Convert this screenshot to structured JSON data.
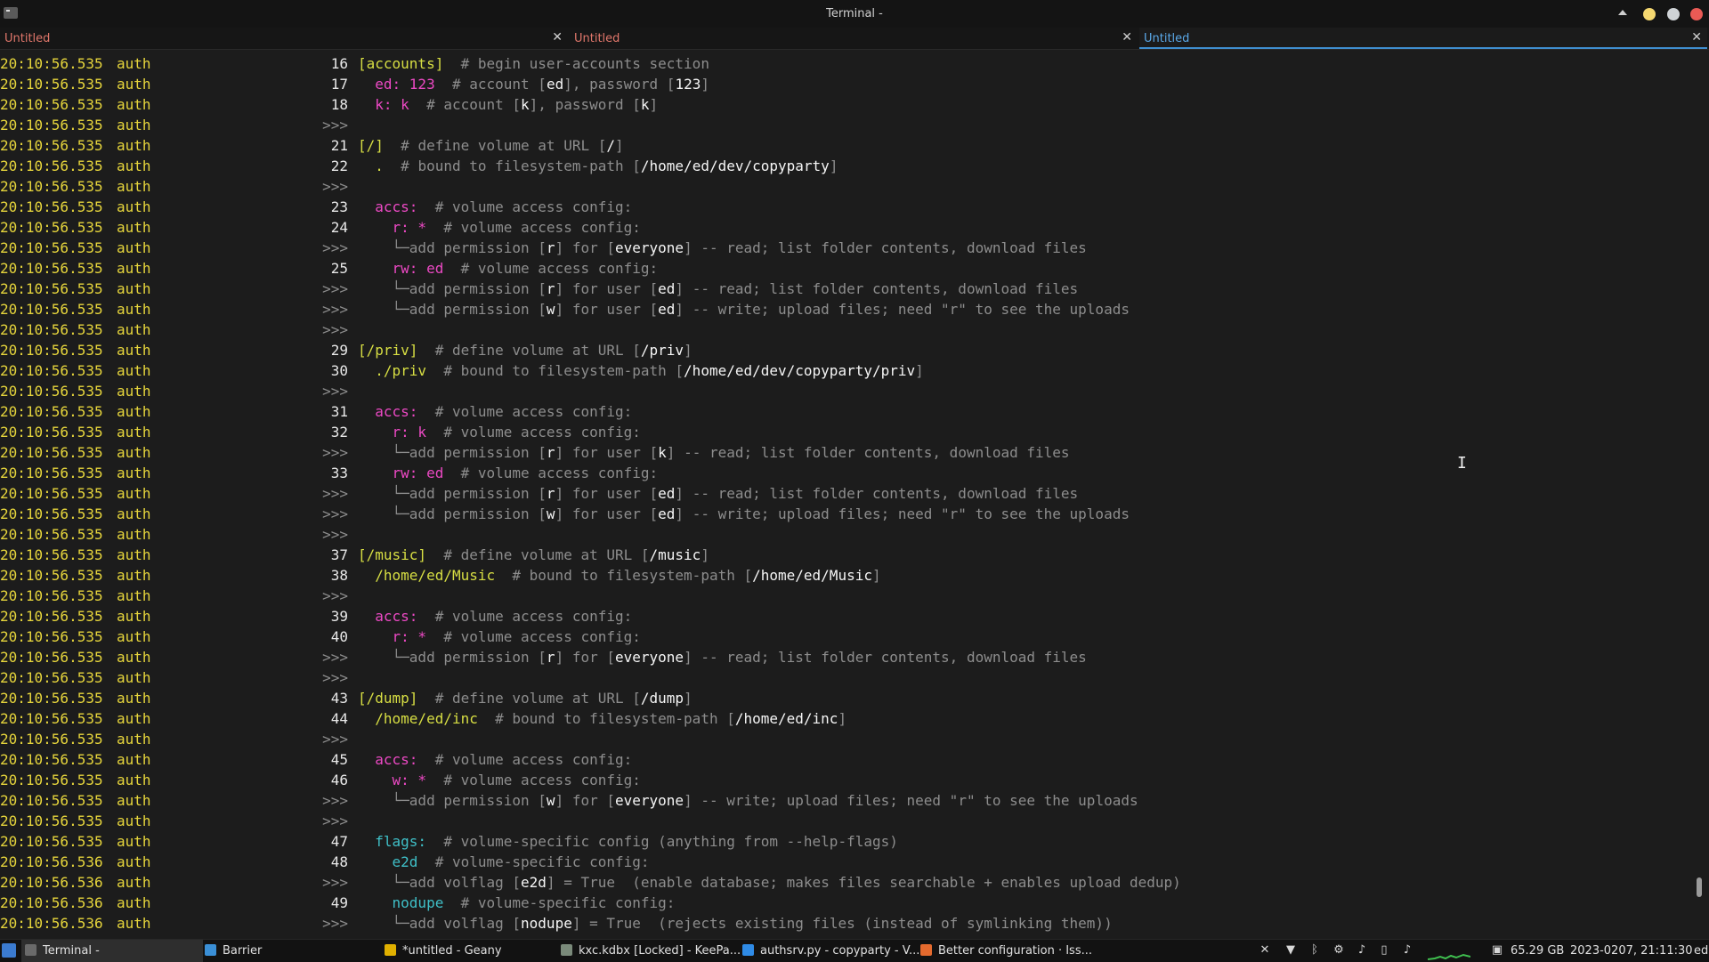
{
  "window": {
    "title": "Terminal -"
  },
  "tabs": [
    {
      "label": "Untitled",
      "close": "✕",
      "active": false
    },
    {
      "label": "Untitled",
      "close": "✕",
      "active": false
    },
    {
      "label": "Untitled",
      "close": "✕",
      "active": true
    }
  ],
  "terminal": {
    "lines": [
      {
        "ts": "20:10:56.535",
        "lvl": "auth",
        "ln": "16",
        "parts": [
          [
            "y",
            "[accounts]"
          ],
          [
            "g",
            "  # begin user-accounts section"
          ]
        ]
      },
      {
        "ts": "20:10:56.535",
        "lvl": "auth",
        "ln": "17",
        "parts": [
          [
            "m",
            "  ed: 123"
          ],
          [
            "g",
            "  # account ["
          ],
          [
            "w",
            "ed"
          ],
          [
            "g",
            "], password ["
          ],
          [
            "w",
            "123"
          ],
          [
            "g",
            "]"
          ]
        ]
      },
      {
        "ts": "20:10:56.535",
        "lvl": "auth",
        "ln": "18",
        "parts": [
          [
            "m",
            "  k: k"
          ],
          [
            "g",
            "  # account ["
          ],
          [
            "w",
            "k"
          ],
          [
            "g",
            "], password ["
          ],
          [
            "w",
            "k"
          ],
          [
            "g",
            "]"
          ]
        ]
      },
      {
        "ts": "20:10:56.535",
        "lvl": "auth",
        "ln": ">>>",
        "parts": []
      },
      {
        "ts": "20:10:56.535",
        "lvl": "auth",
        "ln": "21",
        "parts": [
          [
            "y",
            "[/]"
          ],
          [
            "g",
            "  # define volume at URL ["
          ],
          [
            "w",
            "/"
          ],
          [
            "g",
            "]"
          ]
        ]
      },
      {
        "ts": "20:10:56.535",
        "lvl": "auth",
        "ln": "22",
        "parts": [
          [
            "y",
            "  ."
          ],
          [
            "g",
            "  # bound to filesystem-path ["
          ],
          [
            "w",
            "/home/ed/dev/copyparty"
          ],
          [
            "g",
            "]"
          ]
        ]
      },
      {
        "ts": "20:10:56.535",
        "lvl": "auth",
        "ln": ">>>",
        "parts": []
      },
      {
        "ts": "20:10:56.535",
        "lvl": "auth",
        "ln": "23",
        "parts": [
          [
            "m",
            "  accs:"
          ],
          [
            "g",
            "  # volume access config:"
          ]
        ]
      },
      {
        "ts": "20:10:56.535",
        "lvl": "auth",
        "ln": "24",
        "parts": [
          [
            "m",
            "    r: *"
          ],
          [
            "g",
            "  # volume access config:"
          ]
        ]
      },
      {
        "ts": "20:10:56.535",
        "lvl": "auth",
        "ln": ">>>",
        "parts": [
          [
            "g",
            "    └─add permission ["
          ],
          [
            "w",
            "r"
          ],
          [
            "g",
            "] for ["
          ],
          [
            "w",
            "everyone"
          ],
          [
            "g",
            "] -- read; list folder contents, download files"
          ]
        ]
      },
      {
        "ts": "20:10:56.535",
        "lvl": "auth",
        "ln": "25",
        "parts": [
          [
            "m",
            "    rw: ed"
          ],
          [
            "g",
            "  # volume access config:"
          ]
        ]
      },
      {
        "ts": "20:10:56.535",
        "lvl": "auth",
        "ln": ">>>",
        "parts": [
          [
            "g",
            "    └─add permission ["
          ],
          [
            "w",
            "r"
          ],
          [
            "g",
            "] for user ["
          ],
          [
            "w",
            "ed"
          ],
          [
            "g",
            "] -- read; list folder contents, download files"
          ]
        ]
      },
      {
        "ts": "20:10:56.535",
        "lvl": "auth",
        "ln": ">>>",
        "parts": [
          [
            "g",
            "    └─add permission ["
          ],
          [
            "w",
            "w"
          ],
          [
            "g",
            "] for user ["
          ],
          [
            "w",
            "ed"
          ],
          [
            "g",
            "] -- write; upload files; need \"r\" to see the uploads"
          ]
        ]
      },
      {
        "ts": "20:10:56.535",
        "lvl": "auth",
        "ln": ">>>",
        "parts": []
      },
      {
        "ts": "20:10:56.535",
        "lvl": "auth",
        "ln": "29",
        "parts": [
          [
            "y",
            "[/priv]"
          ],
          [
            "g",
            "  # define volume at URL ["
          ],
          [
            "w",
            "/priv"
          ],
          [
            "g",
            "]"
          ]
        ]
      },
      {
        "ts": "20:10:56.535",
        "lvl": "auth",
        "ln": "30",
        "parts": [
          [
            "y",
            "  ./priv"
          ],
          [
            "g",
            "  # bound to filesystem-path ["
          ],
          [
            "w",
            "/home/ed/dev/copyparty/priv"
          ],
          [
            "g",
            "]"
          ]
        ]
      },
      {
        "ts": "20:10:56.535",
        "lvl": "auth",
        "ln": ">>>",
        "parts": []
      },
      {
        "ts": "20:10:56.535",
        "lvl": "auth",
        "ln": "31",
        "parts": [
          [
            "m",
            "  accs:"
          ],
          [
            "g",
            "  # volume access config:"
          ]
        ]
      },
      {
        "ts": "20:10:56.535",
        "lvl": "auth",
        "ln": "32",
        "parts": [
          [
            "m",
            "    r: k"
          ],
          [
            "g",
            "  # volume access config:"
          ]
        ]
      },
      {
        "ts": "20:10:56.535",
        "lvl": "auth",
        "ln": ">>>",
        "parts": [
          [
            "g",
            "    └─add permission ["
          ],
          [
            "w",
            "r"
          ],
          [
            "g",
            "] for user ["
          ],
          [
            "w",
            "k"
          ],
          [
            "g",
            "] -- read; list folder contents, download files"
          ]
        ]
      },
      {
        "ts": "20:10:56.535",
        "lvl": "auth",
        "ln": "33",
        "parts": [
          [
            "m",
            "    rw: ed"
          ],
          [
            "g",
            "  # volume access config:"
          ]
        ]
      },
      {
        "ts": "20:10:56.535",
        "lvl": "auth",
        "ln": ">>>",
        "parts": [
          [
            "g",
            "    └─add permission ["
          ],
          [
            "w",
            "r"
          ],
          [
            "g",
            "] for user ["
          ],
          [
            "w",
            "ed"
          ],
          [
            "g",
            "] -- read; list folder contents, download files"
          ]
        ]
      },
      {
        "ts": "20:10:56.535",
        "lvl": "auth",
        "ln": ">>>",
        "parts": [
          [
            "g",
            "    └─add permission ["
          ],
          [
            "w",
            "w"
          ],
          [
            "g",
            "] for user ["
          ],
          [
            "w",
            "ed"
          ],
          [
            "g",
            "] -- write; upload files; need \"r\" to see the uploads"
          ]
        ]
      },
      {
        "ts": "20:10:56.535",
        "lvl": "auth",
        "ln": ">>>",
        "parts": []
      },
      {
        "ts": "20:10:56.535",
        "lvl": "auth",
        "ln": "37",
        "parts": [
          [
            "y",
            "[/music]"
          ],
          [
            "g",
            "  # define volume at URL ["
          ],
          [
            "w",
            "/music"
          ],
          [
            "g",
            "]"
          ]
        ]
      },
      {
        "ts": "20:10:56.535",
        "lvl": "auth",
        "ln": "38",
        "parts": [
          [
            "y",
            "  /home/ed/Music"
          ],
          [
            "g",
            "  # bound to filesystem-path ["
          ],
          [
            "w",
            "/home/ed/Music"
          ],
          [
            "g",
            "]"
          ]
        ]
      },
      {
        "ts": "20:10:56.535",
        "lvl": "auth",
        "ln": ">>>",
        "parts": []
      },
      {
        "ts": "20:10:56.535",
        "lvl": "auth",
        "ln": "39",
        "parts": [
          [
            "m",
            "  accs:"
          ],
          [
            "g",
            "  # volume access config:"
          ]
        ]
      },
      {
        "ts": "20:10:56.535",
        "lvl": "auth",
        "ln": "40",
        "parts": [
          [
            "m",
            "    r: *"
          ],
          [
            "g",
            "  # volume access config:"
          ]
        ]
      },
      {
        "ts": "20:10:56.535",
        "lvl": "auth",
        "ln": ">>>",
        "parts": [
          [
            "g",
            "    └─add permission ["
          ],
          [
            "w",
            "r"
          ],
          [
            "g",
            "] for ["
          ],
          [
            "w",
            "everyone"
          ],
          [
            "g",
            "] -- read; list folder contents, download files"
          ]
        ]
      },
      {
        "ts": "20:10:56.535",
        "lvl": "auth",
        "ln": ">>>",
        "parts": []
      },
      {
        "ts": "20:10:56.535",
        "lvl": "auth",
        "ln": "43",
        "parts": [
          [
            "y",
            "[/dump]"
          ],
          [
            "g",
            "  # define volume at URL ["
          ],
          [
            "w",
            "/dump"
          ],
          [
            "g",
            "]"
          ]
        ]
      },
      {
        "ts": "20:10:56.535",
        "lvl": "auth",
        "ln": "44",
        "parts": [
          [
            "y",
            "  /home/ed/inc"
          ],
          [
            "g",
            "  # bound to filesystem-path ["
          ],
          [
            "w",
            "/home/ed/inc"
          ],
          [
            "g",
            "]"
          ]
        ]
      },
      {
        "ts": "20:10:56.535",
        "lvl": "auth",
        "ln": ">>>",
        "parts": []
      },
      {
        "ts": "20:10:56.535",
        "lvl": "auth",
        "ln": "45",
        "parts": [
          [
            "m",
            "  accs:"
          ],
          [
            "g",
            "  # volume access config:"
          ]
        ]
      },
      {
        "ts": "20:10:56.535",
        "lvl": "auth",
        "ln": "46",
        "parts": [
          [
            "m",
            "    w: *"
          ],
          [
            "g",
            "  # volume access config:"
          ]
        ]
      },
      {
        "ts": "20:10:56.535",
        "lvl": "auth",
        "ln": ">>>",
        "parts": [
          [
            "g",
            "    └─add permission ["
          ],
          [
            "w",
            "w"
          ],
          [
            "g",
            "] for ["
          ],
          [
            "w",
            "everyone"
          ],
          [
            "g",
            "] -- write; upload files; need \"r\" to see the uploads"
          ]
        ]
      },
      {
        "ts": "20:10:56.535",
        "lvl": "auth",
        "ln": ">>>",
        "parts": []
      },
      {
        "ts": "20:10:56.535",
        "lvl": "auth",
        "ln": "47",
        "parts": [
          [
            "c",
            "  flags:"
          ],
          [
            "g",
            "  # volume-specific config (anything from --help-flags)"
          ]
        ]
      },
      {
        "ts": "20:10:56.536",
        "lvl": "auth",
        "ln": "48",
        "parts": [
          [
            "c",
            "    e2d"
          ],
          [
            "g",
            "  # volume-specific config:"
          ]
        ]
      },
      {
        "ts": "20:10:56.536",
        "lvl": "auth",
        "ln": ">>>",
        "parts": [
          [
            "g",
            "    └─add volflag ["
          ],
          [
            "w",
            "e2d"
          ],
          [
            "g",
            "] = True  (enable database; makes files searchable + enables upload dedup)"
          ]
        ]
      },
      {
        "ts": "20:10:56.536",
        "lvl": "auth",
        "ln": "49",
        "parts": [
          [
            "c",
            "    nodupe"
          ],
          [
            "g",
            "  # volume-specific config:"
          ]
        ]
      },
      {
        "ts": "20:10:56.536",
        "lvl": "auth",
        "ln": ">>>",
        "parts": [
          [
            "g",
            "    └─add volflag ["
          ],
          [
            "w",
            "nodupe"
          ],
          [
            "g",
            "] = True  (rejects existing files (instead of symlinking them))"
          ]
        ]
      }
    ]
  },
  "taskbar": {
    "items": [
      {
        "label": "Terminal -",
        "icon": "terminal-icon",
        "color": "#6a6a6a",
        "active": true
      },
      {
        "label": "Barrier",
        "icon": "barrier-icon",
        "color": "#3a8fd6",
        "active": false
      },
      {
        "label": "*untitled - Geany",
        "icon": "geany-icon",
        "color": "#e0b000",
        "active": false
      },
      {
        "label": "kxc.kdbx [Locked] - KeePa...",
        "icon": "keepass-icon",
        "color": "#7a8a7a",
        "active": false
      },
      {
        "label": "authsrv.py - copyparty - V...",
        "icon": "vscode-icon",
        "color": "#2f8be6",
        "active": false
      },
      {
        "label": "Better configuration · Iss...",
        "icon": "firefox-icon",
        "color": "#e46a2e",
        "active": false
      }
    ],
    "disk": "65.29 GB",
    "clock": "2023-0207, 21:11:30",
    "user": "ed"
  },
  "colors": {
    "timestamp": "#e6d53c",
    "section": "#d7de43",
    "key": "#ec49c4",
    "comment": "#8d8d8d",
    "value": "#f5f5f5",
    "flag": "#3fc0c8",
    "active_tab": "#5aa8e8",
    "inactive_tab": "#e1776b"
  }
}
